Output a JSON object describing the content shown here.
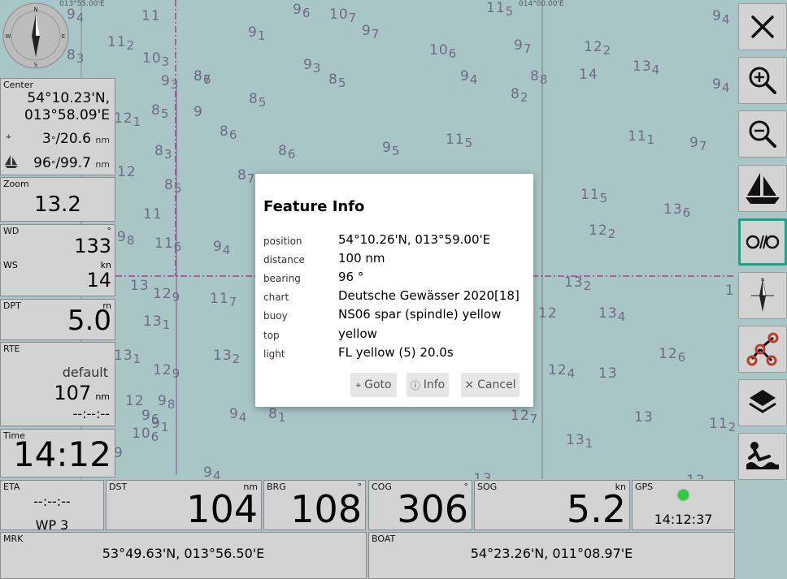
{
  "chart": {
    "coord_labels": [
      "013°55.00'E",
      "014°00.00'E"
    ],
    "depths": [
      {
        "n": "9",
        "s": "4"
      },
      {
        "n": "9",
        "s": "6"
      },
      {
        "n": "11",
        "s": ""
      },
      {
        "n": "10",
        "s": "7"
      },
      {
        "n": "9",
        "s": "7"
      },
      {
        "n": "11",
        "s": "5"
      },
      {
        "n": "9",
        "s": "4"
      },
      {
        "n": "11",
        "s": "2"
      },
      {
        "n": "8",
        "s": "3"
      },
      {
        "n": "9",
        "s": "1"
      },
      {
        "n": "10",
        "s": "6"
      },
      {
        "n": "9",
        "s": "7"
      },
      {
        "n": "12",
        "s": "2"
      },
      {
        "n": "13",
        "s": "4"
      },
      {
        "n": "10",
        "s": "3"
      },
      {
        "n": "9",
        "s": "3"
      },
      {
        "n": "8",
        "s": "6"
      },
      {
        "n": "9",
        "s": "4"
      },
      {
        "n": "8",
        "s": "8"
      },
      {
        "n": "14",
        "s": ""
      },
      {
        "n": "9",
        "s": "4"
      },
      {
        "n": "9",
        "s": "3"
      },
      {
        "n": "8",
        "s": "7"
      },
      {
        "n": "8",
        "s": "5"
      },
      {
        "n": "8",
        "s": "2"
      },
      {
        "n": "11",
        "s": "5"
      },
      {
        "n": "11",
        "s": "1"
      },
      {
        "n": "9",
        "s": "7"
      },
      {
        "n": "12",
        "s": "1"
      },
      {
        "n": "8",
        "s": "5"
      },
      {
        "n": "9",
        "s": ""
      },
      {
        "n": "8",
        "s": "6"
      },
      {
        "n": "9",
        "s": "5"
      },
      {
        "n": "8",
        "s": "5"
      },
      {
        "n": "8",
        "s": "6"
      },
      {
        "n": "12",
        "s": ""
      },
      {
        "n": "8",
        "s": "3"
      },
      {
        "n": "8",
        "s": "7"
      },
      {
        "n": "11",
        "s": "5"
      },
      {
        "n": "13",
        "s": "6"
      },
      {
        "n": "12",
        "s": "2"
      },
      {
        "n": "8",
        "s": "5"
      },
      {
        "n": "11",
        "s": ""
      },
      {
        "n": "9",
        "s": "8"
      },
      {
        "n": "11",
        "s": "6"
      },
      {
        "n": "9",
        "s": "4"
      },
      {
        "n": "13",
        "s": ""
      },
      {
        "n": "12",
        "s": "9"
      },
      {
        "n": "11",
        "s": "7"
      },
      {
        "n": "13",
        "s": "2"
      },
      {
        "n": "12",
        "s": ""
      },
      {
        "n": "13",
        "s": "4"
      },
      {
        "n": "1",
        "s": ""
      },
      {
        "n": "13",
        "s": "1"
      },
      {
        "n": "13",
        "s": "2"
      },
      {
        "n": "12",
        "s": "6"
      },
      {
        "n": "13",
        "s": "1"
      },
      {
        "n": "12",
        "s": "9"
      },
      {
        "n": "12",
        "s": "4"
      },
      {
        "n": "13",
        "s": ""
      },
      {
        "n": "12",
        "s": ""
      },
      {
        "n": "9",
        "s": "8"
      },
      {
        "n": "9",
        "s": "6"
      },
      {
        "n": "9",
        "s": "4"
      },
      {
        "n": "8",
        "s": "1"
      },
      {
        "n": "12",
        "s": "7"
      },
      {
        "n": "13",
        "s": ""
      },
      {
        "n": "11",
        "s": "2"
      },
      {
        "n": "10",
        "s": "6"
      },
      {
        "n": "9",
        "s": "4"
      },
      {
        "n": "13",
        "s": "1"
      },
      {
        "n": "9",
        "s": ""
      },
      {
        "n": "13",
        "s": ""
      },
      {
        "n": "13",
        "s": ""
      },
      {
        "n": "9",
        "s": "1"
      }
    ]
  },
  "widgets": {
    "center": {
      "label": "Center",
      "lat": "54°10.23'N,",
      "lon": "013°58.09'E",
      "dist1_val": "3",
      "dist1_deg": "°",
      "dist1_nm": "/20.6",
      "unit": "nm",
      "dist2_val": "96",
      "dist2_deg": "°",
      "dist2_nm": "/99.7"
    },
    "zoom": {
      "label": "Zoom",
      "value": "13.2"
    },
    "wind": {
      "wd_label": "WD",
      "wd_unit": "°",
      "wd_value": "133",
      "ws_label": "WS",
      "ws_unit": "kn",
      "ws_value": "14"
    },
    "dpt": {
      "label": "DPT",
      "unit": "m",
      "value": "5.0"
    },
    "rte": {
      "label": "RTE",
      "name": "default",
      "dist": "107",
      "unit": "nm",
      "eta": "--:--:--"
    },
    "time": {
      "label": "Time",
      "value": "14:12"
    },
    "eta": {
      "label": "ETA",
      "value": "--:--:--",
      "wp": "WP 3"
    },
    "dst": {
      "label": "DST",
      "unit": "nm",
      "value": "104"
    },
    "brg": {
      "label": "BRG",
      "unit": "°",
      "value": "108"
    },
    "cog": {
      "label": "COG",
      "unit": "°",
      "value": "306"
    },
    "sog": {
      "label": "SOG",
      "unit": "kn",
      "value": "5.2"
    },
    "gps": {
      "label": "GPS",
      "time": "14:12:37",
      "status_color": "#2ecc40"
    },
    "mrk": {
      "label": "MRK",
      "value": "53°49.63'N, 013°56.50'E"
    },
    "boat": {
      "label": "BOAT",
      "value": "54°23.26'N, 011°08.97'E"
    }
  },
  "buttons": [
    {
      "name": "close-icon",
      "active": false
    },
    {
      "name": "zoom-in-icon",
      "active": false
    },
    {
      "name": "zoom-out-icon",
      "active": false
    },
    {
      "name": "sailboat-icon",
      "active": false
    },
    {
      "name": "lock-position-icon",
      "active": true
    },
    {
      "name": "compass-icon",
      "active": false
    },
    {
      "name": "route-icon",
      "active": false
    },
    {
      "name": "layers-icon",
      "active": false
    },
    {
      "name": "anchor-watch-icon",
      "active": false
    }
  ],
  "dialog": {
    "title": "Feature Info",
    "rows": [
      {
        "key": "position",
        "value": "54°10.26'N, 013°59.00'E"
      },
      {
        "key": "distance",
        "value": "100 nm"
      },
      {
        "key": "bearing",
        "value": "96 °"
      },
      {
        "key": "chart",
        "value": "Deutsche Gewässer 2020[18]"
      },
      {
        "key": "buoy",
        "value": "NS06 spar (spindle) yellow"
      },
      {
        "key": "top",
        "value": "yellow"
      },
      {
        "key": "light",
        "value": "FL yellow (5) 20.0s"
      }
    ],
    "goto_label": "Goto",
    "goto_icon": "⌖",
    "info_label": "Info",
    "info_icon": "ⓘ",
    "cancel_label": "Cancel",
    "cancel_icon": "×"
  },
  "colors": {
    "accent": "#17a589",
    "sea": "#a8c6c6",
    "widget_bg": "#d3d3d3",
    "depth_text": "#6f6a86",
    "track_line": "#b03a8e"
  }
}
